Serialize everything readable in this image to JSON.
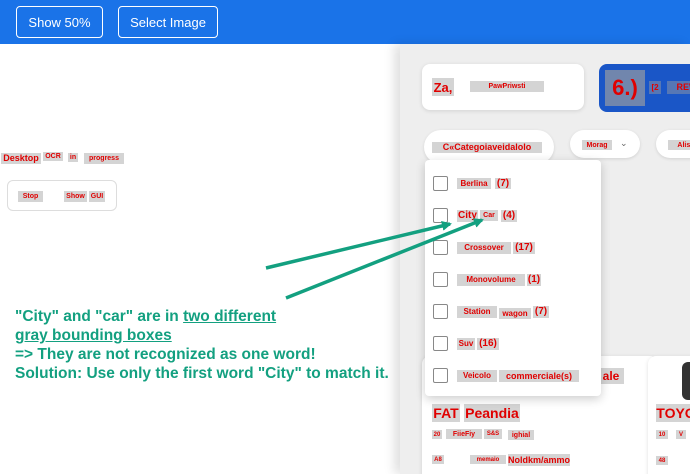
{
  "toolbar": {
    "show_label": "Show 50%",
    "select_label": "Select Image"
  },
  "status": {
    "words": [
      "Desktop",
      "OCR",
      "in",
      "progress"
    ],
    "stop": "Stop",
    "show": "Show",
    "gui": "GUI"
  },
  "preview": {
    "header_left": [
      "Za,",
      "PawPriwsti"
    ],
    "badge_value": "6.)",
    "badge_text": [
      "[2",
      "REW"
    ],
    "filter_category": "C«Categoiaveidalolo",
    "filter_model": "Morag",
    "filter_third": "Alist",
    "options": [
      {
        "words": [
          "Berlina",
          "(7)"
        ]
      },
      {
        "words": [
          "City",
          "Car",
          "(4)"
        ]
      },
      {
        "words": [
          "Crossover",
          "(17)"
        ]
      },
      {
        "words": [
          "Monovolume",
          "(1)"
        ]
      },
      {
        "words": [
          "Station",
          "wagon",
          "(7)"
        ]
      },
      {
        "words": [
          "Suv",
          "(16)"
        ]
      },
      {
        "words": [
          "Veicolo",
          "commerciale(s)"
        ]
      }
    ],
    "ale": "ale",
    "card1_title": [
      "FAT",
      "Peandia"
    ],
    "card1_meta": [
      "20",
      "FiieFiy",
      "S&S",
      "ighial"
    ],
    "card1_footer": [
      "A8",
      "memaio",
      "Noldkm/ammo"
    ],
    "card2_title": "TOYO",
    "card2_meta": [
      "10",
      "V"
    ],
    "card2_footer": "48"
  },
  "annotation": {
    "line1_a": "\"City\" and \"car\" are in ",
    "line1_u": "two different",
    "line2_u": "gray bounding boxes",
    "line3": "=> They are not recognized as one word!",
    "line4": "Solution: Use only the first word \"City\" to match it."
  },
  "colors": {
    "toolbar": "#1a73e8",
    "ocr_text": "#e00000",
    "annotation": "#13a080",
    "badge": "#1a56c7"
  },
  "icons": {
    "arrow": "arrow-icon",
    "dropdown": "chevron-down-icon"
  }
}
